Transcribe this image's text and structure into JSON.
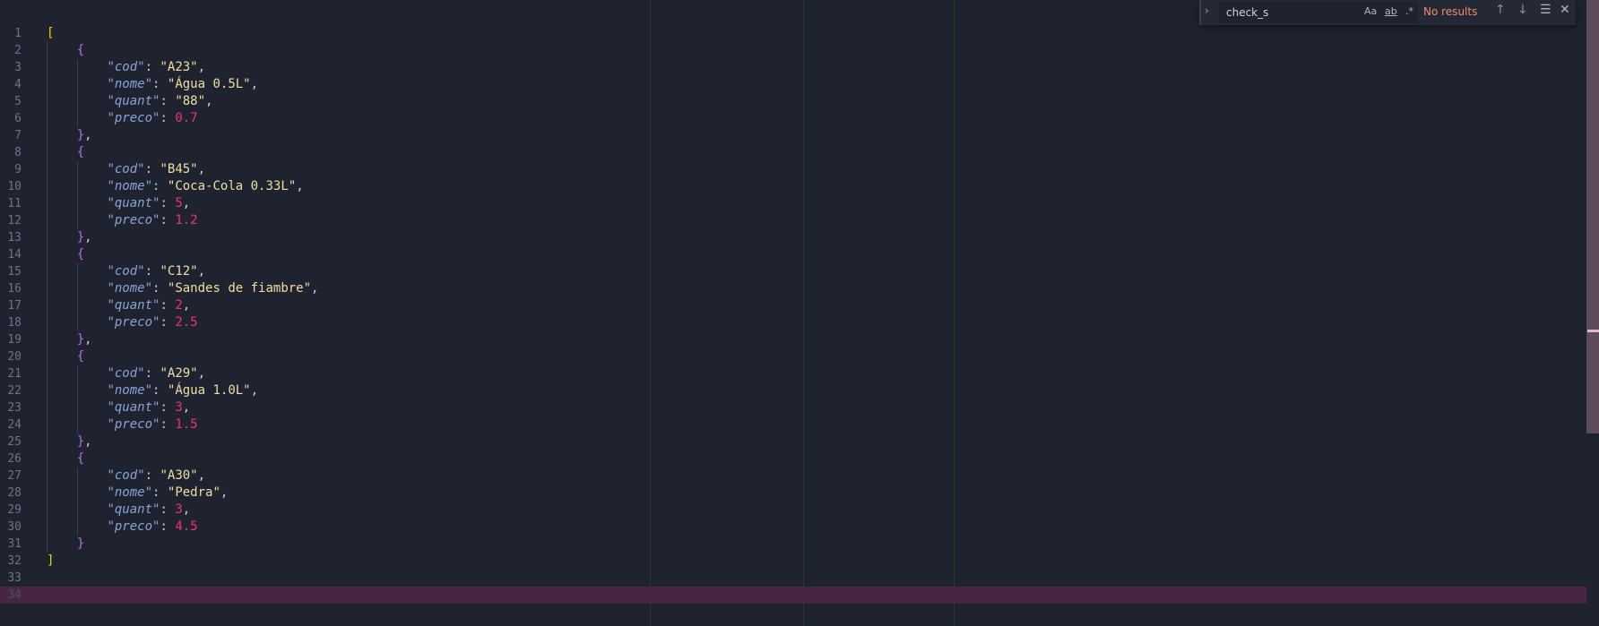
{
  "find_widget": {
    "query": "check_s",
    "match_case_label": "Aa",
    "whole_word_label": "ab",
    "regex_label": ".*",
    "result_text": "No results"
  },
  "editor": {
    "current_line": 34,
    "lines": [
      [
        [
          "brack",
          "["
        ]
      ],
      [
        [
          "ws",
          "    "
        ],
        [
          "brace",
          "{"
        ]
      ],
      [
        [
          "ws",
          "        "
        ],
        [
          "q",
          "\""
        ],
        [
          "key",
          "cod"
        ],
        [
          "q",
          "\""
        ],
        [
          "punc",
          ": "
        ],
        [
          "str",
          "\"A23\""
        ],
        [
          "punc",
          ","
        ]
      ],
      [
        [
          "ws",
          "        "
        ],
        [
          "q",
          "\""
        ],
        [
          "key",
          "nome"
        ],
        [
          "q",
          "\""
        ],
        [
          "punc",
          ": "
        ],
        [
          "str",
          "\"Água 0.5L\""
        ],
        [
          "punc",
          ","
        ]
      ],
      [
        [
          "ws",
          "        "
        ],
        [
          "q",
          "\""
        ],
        [
          "key",
          "quant"
        ],
        [
          "q",
          "\""
        ],
        [
          "punc",
          ": "
        ],
        [
          "str",
          "\"88\""
        ],
        [
          "punc",
          ","
        ]
      ],
      [
        [
          "ws",
          "        "
        ],
        [
          "q",
          "\""
        ],
        [
          "key",
          "preco"
        ],
        [
          "q",
          "\""
        ],
        [
          "punc",
          ": "
        ],
        [
          "num",
          "0.7"
        ]
      ],
      [
        [
          "ws",
          "    "
        ],
        [
          "brace",
          "}"
        ],
        [
          "punc",
          ","
        ]
      ],
      [
        [
          "ws",
          "    "
        ],
        [
          "brace",
          "{"
        ]
      ],
      [
        [
          "ws",
          "        "
        ],
        [
          "q",
          "\""
        ],
        [
          "key",
          "cod"
        ],
        [
          "q",
          "\""
        ],
        [
          "punc",
          ": "
        ],
        [
          "str",
          "\"B45\""
        ],
        [
          "punc",
          ","
        ]
      ],
      [
        [
          "ws",
          "        "
        ],
        [
          "q",
          "\""
        ],
        [
          "key",
          "nome"
        ],
        [
          "q",
          "\""
        ],
        [
          "punc",
          ": "
        ],
        [
          "str",
          "\"Coca-Cola 0.33L\""
        ],
        [
          "punc",
          ","
        ]
      ],
      [
        [
          "ws",
          "        "
        ],
        [
          "q",
          "\""
        ],
        [
          "key",
          "quant"
        ],
        [
          "q",
          "\""
        ],
        [
          "punc",
          ": "
        ],
        [
          "num",
          "5"
        ],
        [
          "punc",
          ","
        ]
      ],
      [
        [
          "ws",
          "        "
        ],
        [
          "q",
          "\""
        ],
        [
          "key",
          "preco"
        ],
        [
          "q",
          "\""
        ],
        [
          "punc",
          ": "
        ],
        [
          "num",
          "1.2"
        ]
      ],
      [
        [
          "ws",
          "    "
        ],
        [
          "brace",
          "}"
        ],
        [
          "punc",
          ","
        ]
      ],
      [
        [
          "ws",
          "    "
        ],
        [
          "brace",
          "{"
        ]
      ],
      [
        [
          "ws",
          "        "
        ],
        [
          "q",
          "\""
        ],
        [
          "key",
          "cod"
        ],
        [
          "q",
          "\""
        ],
        [
          "punc",
          ": "
        ],
        [
          "str",
          "\"C12\""
        ],
        [
          "punc",
          ","
        ]
      ],
      [
        [
          "ws",
          "        "
        ],
        [
          "q",
          "\""
        ],
        [
          "key",
          "nome"
        ],
        [
          "q",
          "\""
        ],
        [
          "punc",
          ": "
        ],
        [
          "str",
          "\"Sandes de fiambre\""
        ],
        [
          "punc",
          ","
        ]
      ],
      [
        [
          "ws",
          "        "
        ],
        [
          "q",
          "\""
        ],
        [
          "key",
          "quant"
        ],
        [
          "q",
          "\""
        ],
        [
          "punc",
          ": "
        ],
        [
          "num",
          "2"
        ],
        [
          "punc",
          ","
        ]
      ],
      [
        [
          "ws",
          "        "
        ],
        [
          "q",
          "\""
        ],
        [
          "key",
          "preco"
        ],
        [
          "q",
          "\""
        ],
        [
          "punc",
          ": "
        ],
        [
          "num",
          "2.5"
        ]
      ],
      [
        [
          "ws",
          "    "
        ],
        [
          "brace",
          "}"
        ],
        [
          "punc",
          ","
        ]
      ],
      [
        [
          "ws",
          "    "
        ],
        [
          "brace",
          "{"
        ]
      ],
      [
        [
          "ws",
          "        "
        ],
        [
          "q",
          "\""
        ],
        [
          "key",
          "cod"
        ],
        [
          "q",
          "\""
        ],
        [
          "punc",
          ": "
        ],
        [
          "str",
          "\"A29\""
        ],
        [
          "punc",
          ","
        ]
      ],
      [
        [
          "ws",
          "        "
        ],
        [
          "q",
          "\""
        ],
        [
          "key",
          "nome"
        ],
        [
          "q",
          "\""
        ],
        [
          "punc",
          ": "
        ],
        [
          "str",
          "\"Água 1.0L\""
        ],
        [
          "punc",
          ","
        ]
      ],
      [
        [
          "ws",
          "        "
        ],
        [
          "q",
          "\""
        ],
        [
          "key",
          "quant"
        ],
        [
          "q",
          "\""
        ],
        [
          "punc",
          ": "
        ],
        [
          "num",
          "3"
        ],
        [
          "punc",
          ","
        ]
      ],
      [
        [
          "ws",
          "        "
        ],
        [
          "q",
          "\""
        ],
        [
          "key",
          "preco"
        ],
        [
          "q",
          "\""
        ],
        [
          "punc",
          ": "
        ],
        [
          "num",
          "1.5"
        ]
      ],
      [
        [
          "ws",
          "    "
        ],
        [
          "brace",
          "}"
        ],
        [
          "punc",
          ","
        ]
      ],
      [
        [
          "ws",
          "    "
        ],
        [
          "brace",
          "{"
        ]
      ],
      [
        [
          "ws",
          "        "
        ],
        [
          "q",
          "\""
        ],
        [
          "key",
          "cod"
        ],
        [
          "q",
          "\""
        ],
        [
          "punc",
          ": "
        ],
        [
          "str",
          "\"A30\""
        ],
        [
          "punc",
          ","
        ]
      ],
      [
        [
          "ws",
          "        "
        ],
        [
          "q",
          "\""
        ],
        [
          "key",
          "nome"
        ],
        [
          "q",
          "\""
        ],
        [
          "punc",
          ": "
        ],
        [
          "str",
          "\"Pedra\""
        ],
        [
          "punc",
          ","
        ]
      ],
      [
        [
          "ws",
          "        "
        ],
        [
          "q",
          "\""
        ],
        [
          "key",
          "quant"
        ],
        [
          "q",
          "\""
        ],
        [
          "punc",
          ": "
        ],
        [
          "num",
          "3"
        ],
        [
          "punc",
          ","
        ]
      ],
      [
        [
          "ws",
          "        "
        ],
        [
          "q",
          "\""
        ],
        [
          "key",
          "preco"
        ],
        [
          "q",
          "\""
        ],
        [
          "punc",
          ": "
        ],
        [
          "num",
          "4.5"
        ]
      ],
      [
        [
          "ws",
          "    "
        ],
        [
          "brace",
          "}"
        ]
      ],
      [
        [
          "brack",
          "]"
        ]
      ],
      [],
      []
    ]
  }
}
